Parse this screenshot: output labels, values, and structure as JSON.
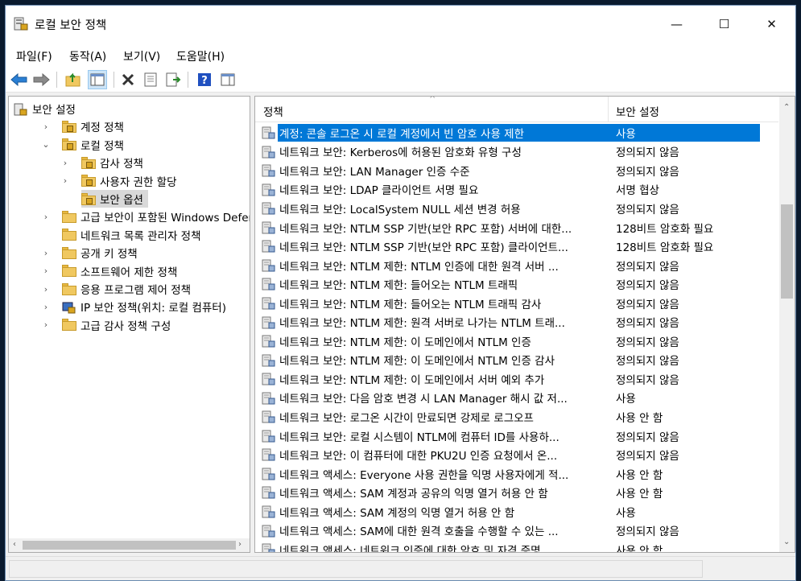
{
  "window": {
    "title": "로컬 보안 정책",
    "caption_min": "—",
    "caption_max": "☐",
    "caption_close": "✕"
  },
  "menu": [
    "파일(F)",
    "동작(A)",
    "보기(V)",
    "도움말(H)"
  ],
  "toolbar": {
    "buttons": [
      "back-icon",
      "forward-icon",
      "up-folder-icon",
      "show-tree-icon",
      "delete-icon",
      "properties-icon",
      "export-icon",
      "help-icon",
      "console-icon"
    ]
  },
  "tree": [
    {
      "label": "보안 설정",
      "level": 0,
      "expander": "",
      "icon": "security-settings-icon"
    },
    {
      "label": "계정 정책",
      "level": 1,
      "expander": "›",
      "icon": "locked-folder-icon"
    },
    {
      "label": "로컬 정책",
      "level": 1,
      "expander": "⌄",
      "icon": "locked-folder-icon"
    },
    {
      "label": "감사 정책",
      "level": 2,
      "expander": "›",
      "icon": "locked-folder-icon"
    },
    {
      "label": "사용자 권한 할당",
      "level": 2,
      "expander": "›",
      "icon": "locked-folder-icon"
    },
    {
      "label": "보안 옵션",
      "level": 2,
      "expander": "",
      "icon": "locked-folder-icon",
      "selected": true
    },
    {
      "label": "고급 보안이 포함된 Windows Defenc",
      "level": 1,
      "expander": "›",
      "icon": "folder-icon"
    },
    {
      "label": "네트워크 목록 관리자 정책",
      "level": 1,
      "expander": "",
      "icon": "folder-icon"
    },
    {
      "label": "공개 키 정책",
      "level": 1,
      "expander": "›",
      "icon": "folder-icon"
    },
    {
      "label": "소프트웨어 제한 정책",
      "level": 1,
      "expander": "›",
      "icon": "folder-icon"
    },
    {
      "label": "응용 프로그램 제어 정책",
      "level": 1,
      "expander": "›",
      "icon": "folder-icon"
    },
    {
      "label": "IP 보안 정책(위치: 로컬 컴퓨터)",
      "level": 1,
      "expander": "›",
      "icon": "ip-security-icon"
    },
    {
      "label": "고급 감사 정책 구성",
      "level": 1,
      "expander": "›",
      "icon": "folder-icon"
    }
  ],
  "list": {
    "col_policy": "정책",
    "col_setting": "보안 설정",
    "rows": [
      {
        "policy": "계정: 콘솔 로그온 시 로컬 계정에서 빈 암호 사용 제한",
        "setting": "사용",
        "selected": true
      },
      {
        "policy": "네트워크 보안: Kerberos에 허용된 암호화 유형 구성",
        "setting": "정의되지 않음"
      },
      {
        "policy": "네트워크 보안: LAN Manager 인증 수준",
        "setting": "정의되지 않음"
      },
      {
        "policy": "네트워크 보안: LDAP 클라이언트 서명 필요",
        "setting": "서명 협상"
      },
      {
        "policy": "네트워크 보안: LocalSystem NULL 세션 변경 허용",
        "setting": "정의되지 않음"
      },
      {
        "policy": "네트워크 보안: NTLM SSP 기반(보안 RPC 포함) 서버에 대한...",
        "setting": "128비트 암호화 필요"
      },
      {
        "policy": "네트워크 보안: NTLM SSP 기반(보안 RPC 포함) 클라이언트...",
        "setting": "128비트 암호화 필요"
      },
      {
        "policy": "네트워크 보안: NTLM 제한: NTLM 인증에 대한 원격 서버 ...",
        "setting": "정의되지 않음"
      },
      {
        "policy": "네트워크 보안: NTLM 제한: 들어오는 NTLM 트래픽",
        "setting": "정의되지 않음"
      },
      {
        "policy": "네트워크 보안: NTLM 제한: 들어오는 NTLM 트래픽 감사",
        "setting": "정의되지 않음"
      },
      {
        "policy": "네트워크 보안: NTLM 제한: 원격 서버로 나가는 NTLM 트래...",
        "setting": "정의되지 않음"
      },
      {
        "policy": "네트워크 보안: NTLM 제한: 이 도메인에서 NTLM 인증",
        "setting": "정의되지 않음"
      },
      {
        "policy": "네트워크 보안: NTLM 제한: 이 도메인에서 NTLM 인증 감사",
        "setting": "정의되지 않음"
      },
      {
        "policy": "네트워크 보안: NTLM 제한: 이 도메인에서 서버 예외 추가",
        "setting": "정의되지 않음"
      },
      {
        "policy": "네트워크 보안: 다음 암호 변경 시 LAN Manager 해시 값 저...",
        "setting": "사용"
      },
      {
        "policy": "네트워크 보안: 로그온 시간이 만료되면 강제로 로그오프",
        "setting": "사용 안 함"
      },
      {
        "policy": "네트워크 보안: 로컬 시스템이 NTLM에 컴퓨터 ID를 사용하...",
        "setting": "정의되지 않음"
      },
      {
        "policy": "네트워크 보안: 이 컴퓨터에 대한 PKU2U 인증 요청에서 온...",
        "setting": "정의되지 않음"
      },
      {
        "policy": "네트워크 액세스: Everyone 사용 권한을 익명 사용자에게 적...",
        "setting": "사용 안 함"
      },
      {
        "policy": "네트워크 액세스: SAM 계정과 공유의 익명 열거 허용 안 함",
        "setting": "사용 안 함"
      },
      {
        "policy": "네트워크 액세스: SAM 계정의 익명 열거 허용 안 함",
        "setting": "사용"
      },
      {
        "policy": "네트워크 액세스: SAM에 대한 원격 호출을 수행할 수 있는 ...",
        "setting": "정의되지 않음"
      },
      {
        "policy": "네트워크 액세스: 네트워크 인증에 대한 암호 및 자격 증명...",
        "setting": "사용 안 함"
      }
    ]
  },
  "colors": {
    "selection": "#0078d7",
    "tree_selection": "#d9d9d9"
  }
}
